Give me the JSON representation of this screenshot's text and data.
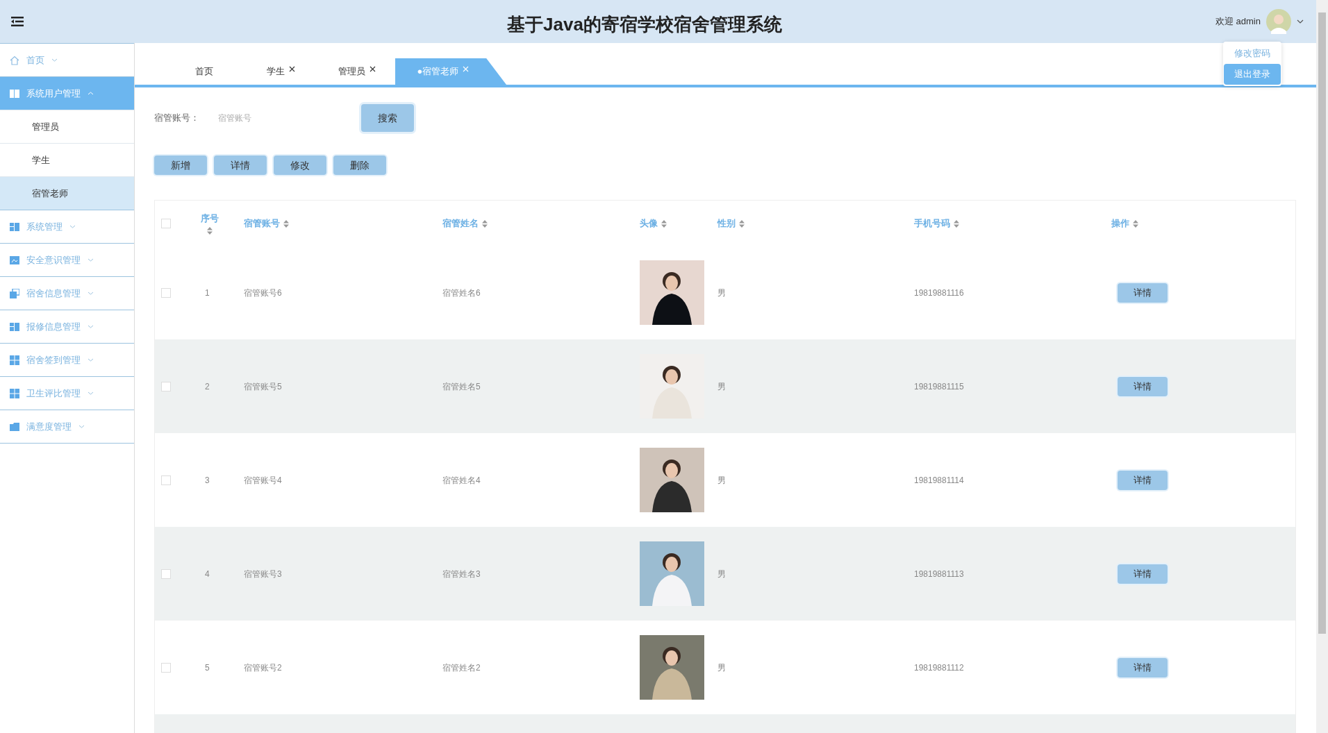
{
  "header": {
    "title": "基于Java的寄宿学校宿舍管理系统",
    "welcome": "欢迎 admin"
  },
  "user_menu": [
    {
      "label": "修改密码",
      "selected": false
    },
    {
      "label": "退出登录",
      "selected": true
    }
  ],
  "sidebar": {
    "items": [
      {
        "label": "首页",
        "expanded": false
      },
      {
        "label": "系统用户管理",
        "expanded": true,
        "children": [
          {
            "label": "管理员",
            "selected": false
          },
          {
            "label": "学生",
            "selected": false
          },
          {
            "label": "宿管老师",
            "selected": true
          }
        ]
      },
      {
        "label": "系统管理",
        "expanded": false
      },
      {
        "label": "安全意识管理",
        "expanded": false
      },
      {
        "label": "宿舍信息管理",
        "expanded": false
      },
      {
        "label": "报修信息管理",
        "expanded": false
      },
      {
        "label": "宿舍签到管理",
        "expanded": false
      },
      {
        "label": "卫生评比管理",
        "expanded": false
      },
      {
        "label": "满意度管理",
        "expanded": false
      }
    ]
  },
  "tabs": [
    {
      "label": "首页",
      "selected": false,
      "closable": false
    },
    {
      "label": "学生",
      "selected": false,
      "closable": true
    },
    {
      "label": "管理员",
      "selected": false,
      "closable": true
    },
    {
      "label": "●宿管老师",
      "selected": true,
      "closable": true
    }
  ],
  "search": {
    "label": "宿管账号：",
    "placeholder": "宿管账号",
    "button": "搜索"
  },
  "actions": [
    "新增",
    "详情",
    "修改",
    "删除"
  ],
  "table": {
    "all_checked": false,
    "columns": [
      "序号",
      "宿管账号",
      "宿管姓名",
      "头像",
      "性别",
      "手机号码",
      "操作"
    ],
    "rows": [
      {
        "checked": false,
        "no": "1",
        "account": "宿管账号6",
        "name": "宿管姓名6",
        "gender": "男",
        "phone": "19819881116",
        "action": "详情"
      },
      {
        "checked": false,
        "no": "2",
        "account": "宿管账号5",
        "name": "宿管姓名5",
        "gender": "男",
        "phone": "19819881115",
        "action": "详情"
      },
      {
        "checked": false,
        "no": "3",
        "account": "宿管账号4",
        "name": "宿管姓名4",
        "gender": "男",
        "phone": "19819881114",
        "action": "详情"
      },
      {
        "checked": false,
        "no": "4",
        "account": "宿管账号3",
        "name": "宿管姓名3",
        "gender": "男",
        "phone": "19819881113",
        "action": "详情"
      },
      {
        "checked": false,
        "no": "5",
        "account": "宿管账号2",
        "name": "宿管姓名2",
        "gender": "男",
        "phone": "19819881112",
        "action": "详情"
      }
    ]
  }
}
